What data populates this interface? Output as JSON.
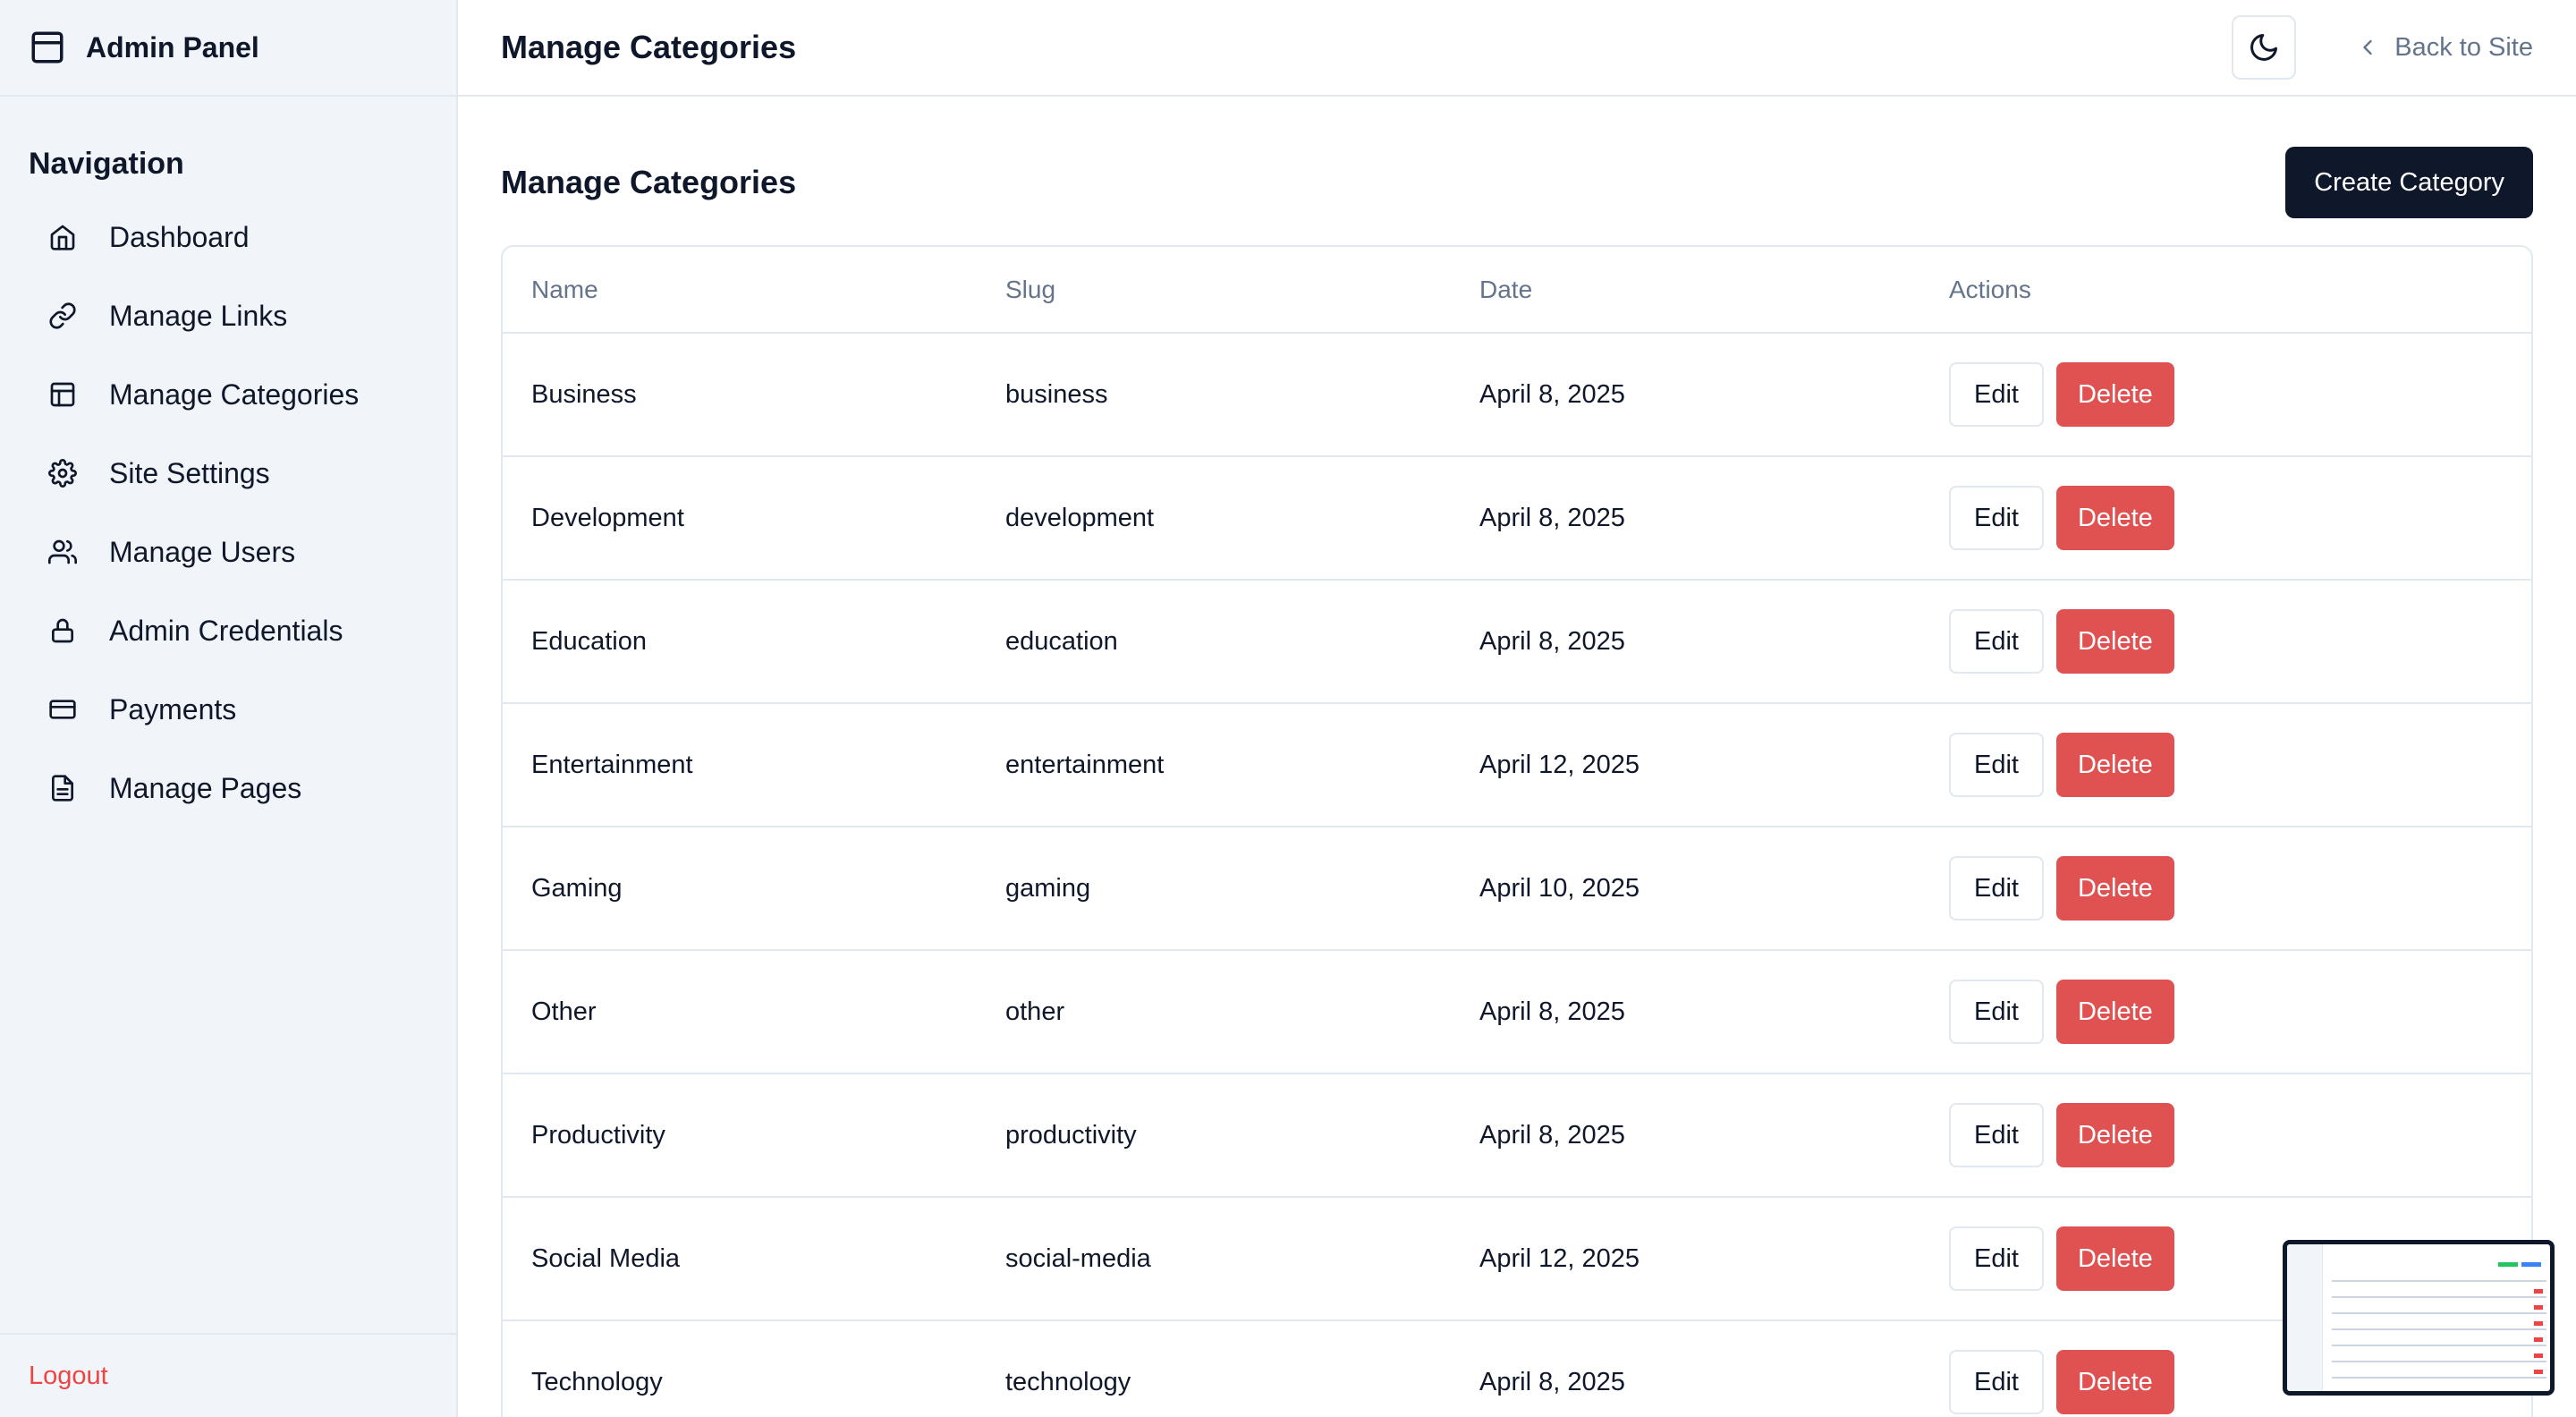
{
  "sidebar": {
    "brand_title": "Admin Panel",
    "nav_heading": "Navigation",
    "items": [
      {
        "label": "Dashboard",
        "icon": "home-icon"
      },
      {
        "label": "Manage Links",
        "icon": "link-icon"
      },
      {
        "label": "Manage Categories",
        "icon": "layout-icon"
      },
      {
        "label": "Site Settings",
        "icon": "gear-icon"
      },
      {
        "label": "Manage Users",
        "icon": "users-icon"
      },
      {
        "label": "Admin Credentials",
        "icon": "lock-icon"
      },
      {
        "label": "Payments",
        "icon": "credit-card-icon"
      },
      {
        "label": "Manage Pages",
        "icon": "file-icon"
      }
    ],
    "logout_label": "Logout"
  },
  "header": {
    "title": "Manage Categories",
    "back_label": "Back to Site"
  },
  "main": {
    "title": "Manage Categories",
    "create_label": "Create Category",
    "columns": [
      "Name",
      "Slug",
      "Date",
      "Actions"
    ],
    "edit_label": "Edit",
    "delete_label": "Delete",
    "rows": [
      {
        "name": "Business",
        "slug": "business",
        "date": "April 8, 2025"
      },
      {
        "name": "Development",
        "slug": "development",
        "date": "April 8, 2025"
      },
      {
        "name": "Education",
        "slug": "education",
        "date": "April 8, 2025"
      },
      {
        "name": "Entertainment",
        "slug": "entertainment",
        "date": "April 12, 2025"
      },
      {
        "name": "Gaming",
        "slug": "gaming",
        "date": "April 10, 2025"
      },
      {
        "name": "Other",
        "slug": "other",
        "date": "April 8, 2025"
      },
      {
        "name": "Productivity",
        "slug": "productivity",
        "date": "April 8, 2025"
      },
      {
        "name": "Social Media",
        "slug": "social-media",
        "date": "April 12, 2025"
      },
      {
        "name": "Technology",
        "slug": "technology",
        "date": "April 8, 2025"
      }
    ]
  },
  "colors": {
    "primary": "#0f172a",
    "danger": "#e05252",
    "sidebar_bg": "#f1f5f9",
    "muted_text": "#64748b",
    "border": "#e2e8f0"
  }
}
